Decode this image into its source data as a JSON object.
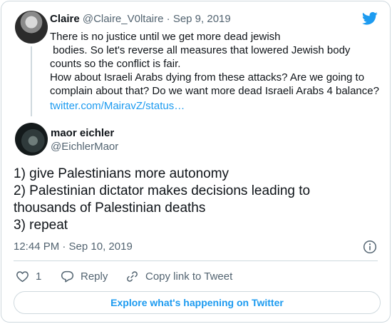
{
  "parent_tweet": {
    "name": "Claire",
    "handle": "@Claire_V0ltaire",
    "separator": "·",
    "date": "Sep 9, 2019",
    "text_lines": [
      "There is no justice until we get more dead jewish",
      " bodies. So let's reverse all measures that lowered Jewish body",
      "counts so the conflict is fair.",
      "How about Israeli Arabs dying from these attacks? Are we going to",
      "complain about that? Do we want more dead Israeli Arabs 4 balance?"
    ],
    "link": "twitter.com/MairavZ/status…"
  },
  "main_tweet": {
    "name": "maor eichler",
    "handle": "@EichlerMaor",
    "text_lines": [
      "1) give Palestinians more autonomy",
      "2) Palestinian dictator makes decisions leading to",
      "thousands of Palestinian deaths",
      "3) repeat"
    ],
    "timestamp": "12:44 PM · Sep 10, 2019"
  },
  "actions": {
    "like_count": "1",
    "reply_label": "Reply",
    "copy_link_label": "Copy link to Tweet"
  },
  "explore_label": "Explore what's happening on Twitter",
  "icons": {
    "brand": "twitter-bird-icon",
    "info": "info-icon",
    "like": "heart-icon",
    "reply": "speech-bubble-icon",
    "copy": "link-icon"
  },
  "colors": {
    "brand_blue": "#1d9bf0",
    "muted_text": "#536471",
    "border": "#cfd9de"
  }
}
